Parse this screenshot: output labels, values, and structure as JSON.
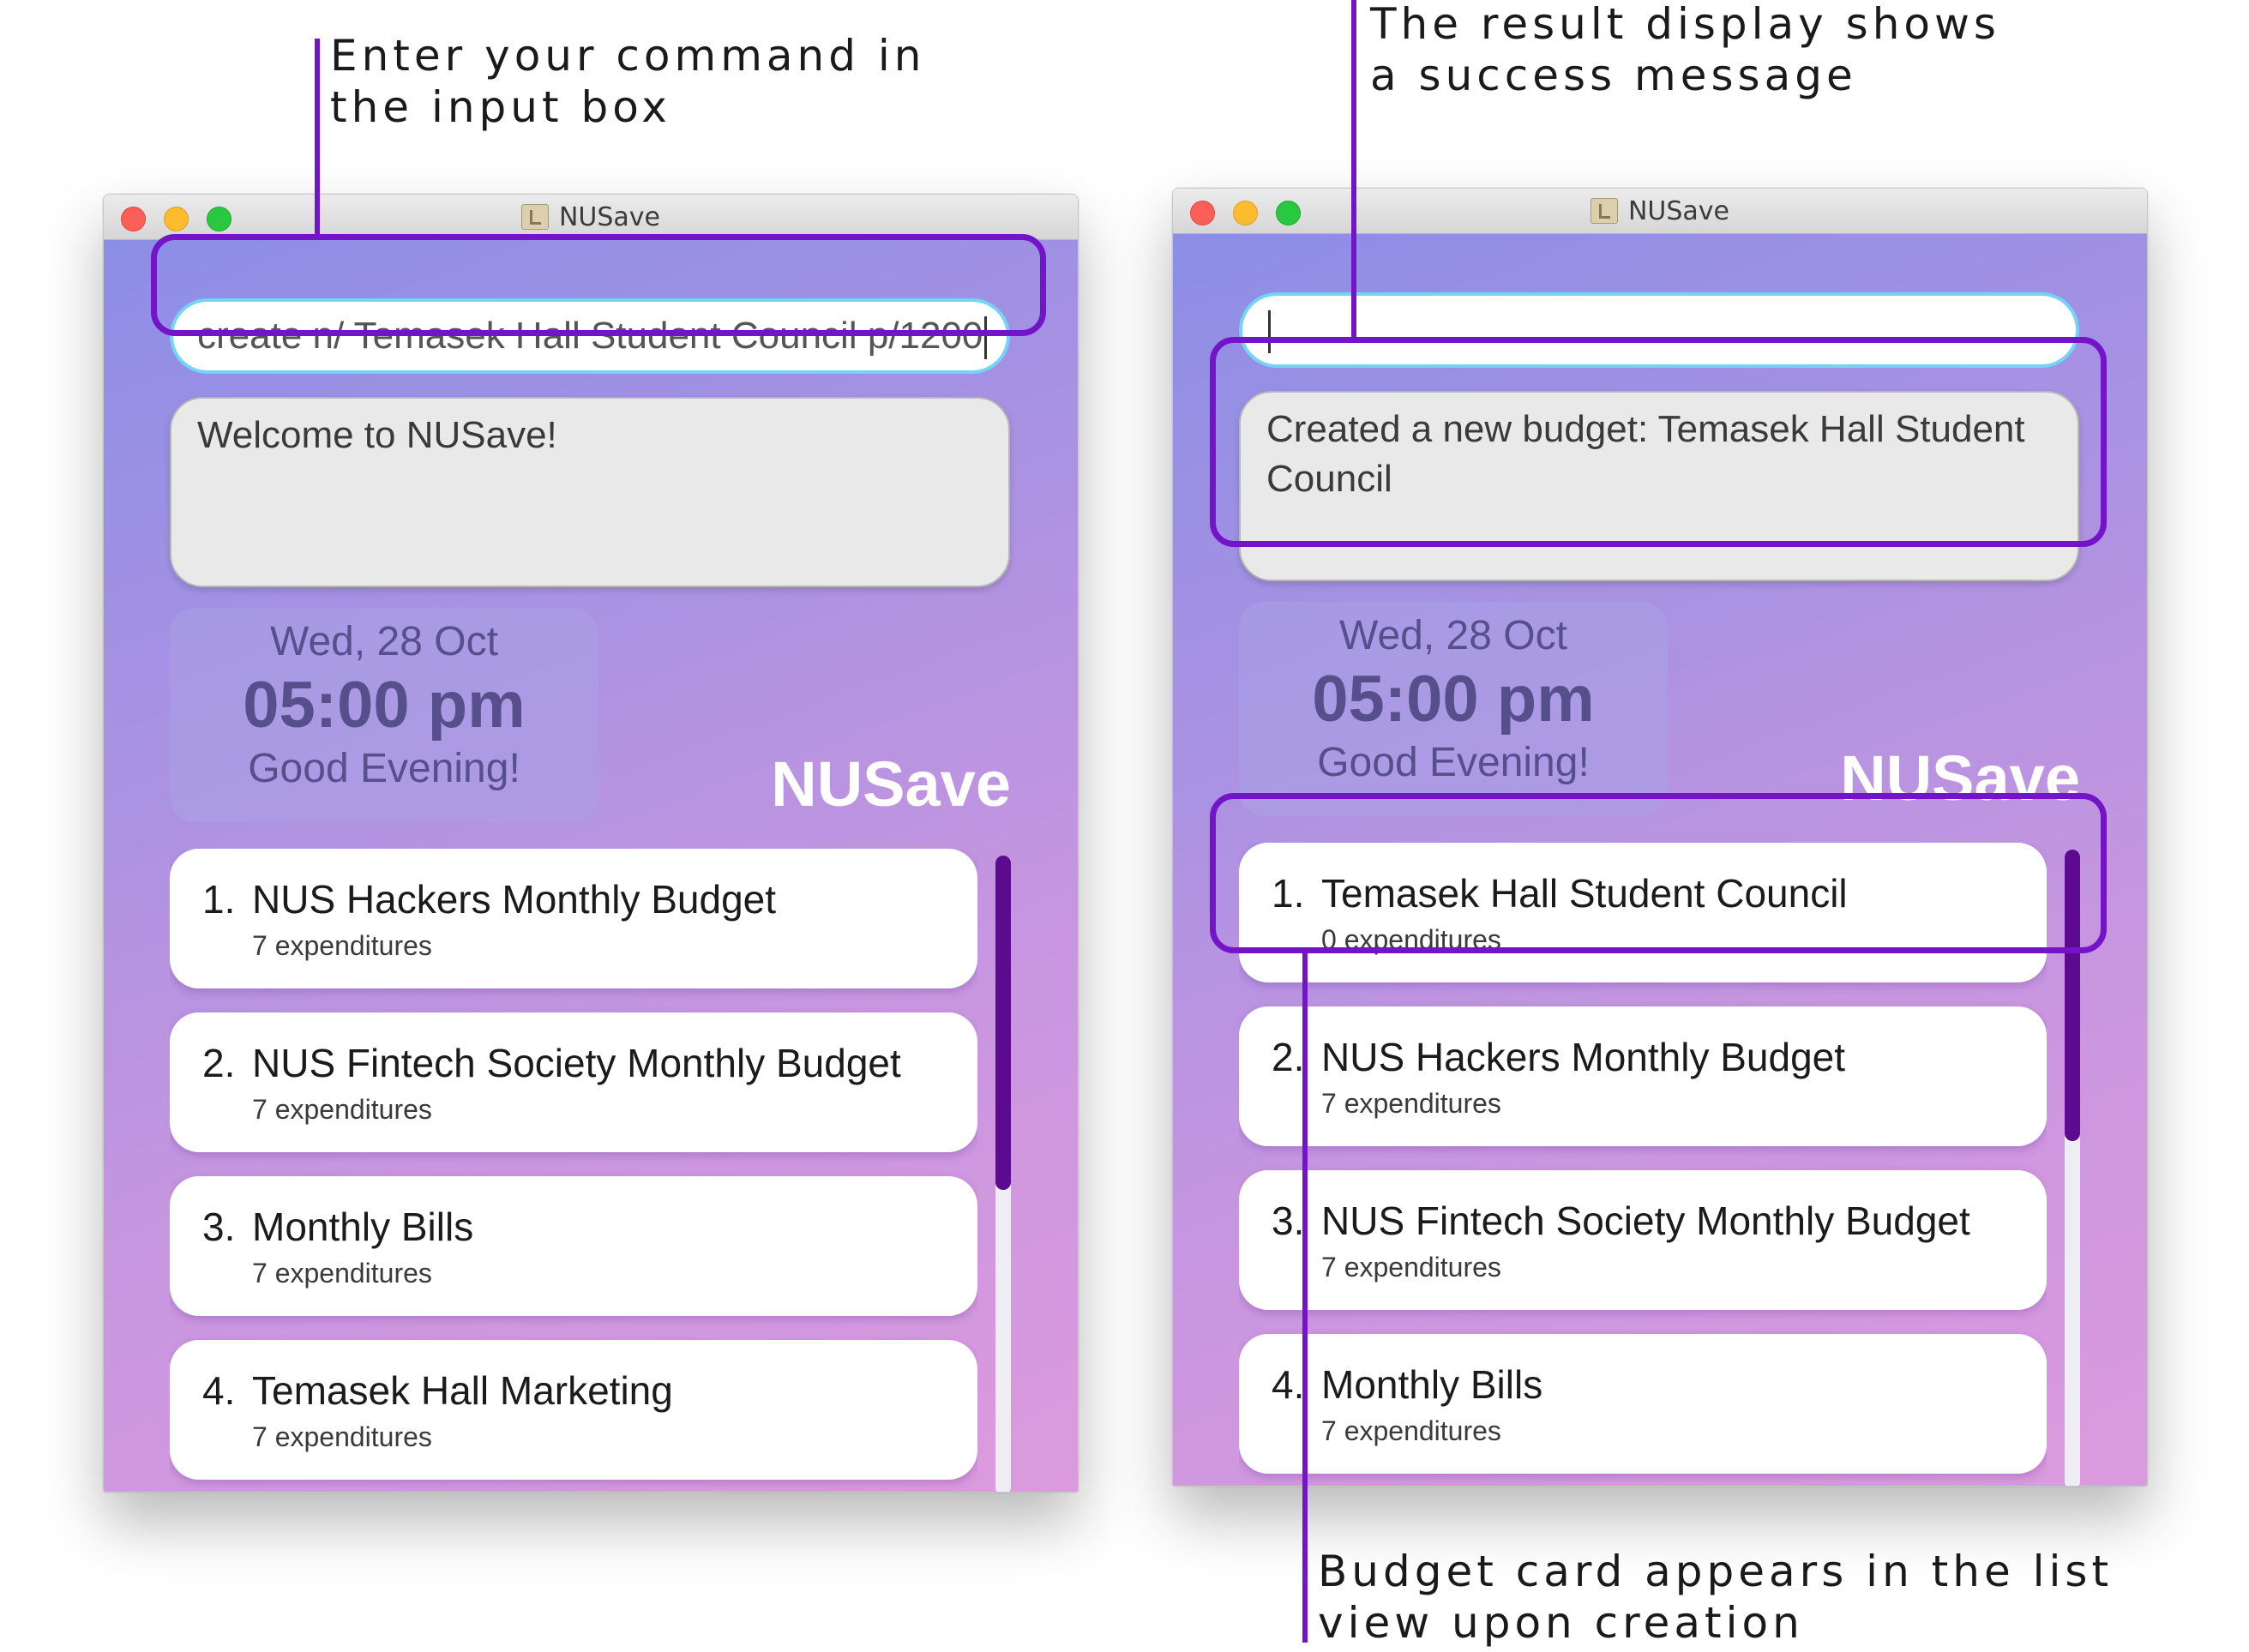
{
  "callouts": {
    "input": "Enter your command in\nthe input box",
    "result": "The result display shows\na success message",
    "list": "Budget card appears in the list\nview upon creation"
  },
  "before": {
    "window_title": "NUSave",
    "command_input": "create n/ Temasek Hall Student Council p/1200",
    "result_text": "Welcome to NUSave!",
    "clock": {
      "date": "Wed, 28 Oct",
      "time": "05:00 pm",
      "greeting": "Good Evening!"
    },
    "brand": "NUSave",
    "budgets": [
      {
        "index": "1.",
        "name": "NUS Hackers Monthly Budget",
        "subtitle": "7 expenditures"
      },
      {
        "index": "2.",
        "name": "NUS Fintech Society Monthly Budget",
        "subtitle": "7 expenditures"
      },
      {
        "index": "3.",
        "name": "Monthly Bills",
        "subtitle": "7 expenditures"
      },
      {
        "index": "4.",
        "name": "Temasek Hall Marketing",
        "subtitle": "7 expenditures"
      }
    ]
  },
  "after": {
    "window_title": "NUSave",
    "command_input": "",
    "result_text": "Created a new budget: Temasek Hall Student Council",
    "clock": {
      "date": "Wed, 28 Oct",
      "time": "05:00 pm",
      "greeting": "Good Evening!"
    },
    "brand": "NUSave",
    "budgets": [
      {
        "index": "1.",
        "name": "Temasek Hall Student Council",
        "subtitle": "0 expenditures"
      },
      {
        "index": "2.",
        "name": "NUS Hackers Monthly Budget",
        "subtitle": "7 expenditures"
      },
      {
        "index": "3.",
        "name": "NUS Fintech Society Monthly Budget",
        "subtitle": "7 expenditures"
      },
      {
        "index": "4.",
        "name": "Monthly Bills",
        "subtitle": "7 expenditures"
      }
    ]
  },
  "colors": {
    "annotation": "#7314c9",
    "input_border": "#73d4f7",
    "scrollbar": "#5c0b91"
  }
}
